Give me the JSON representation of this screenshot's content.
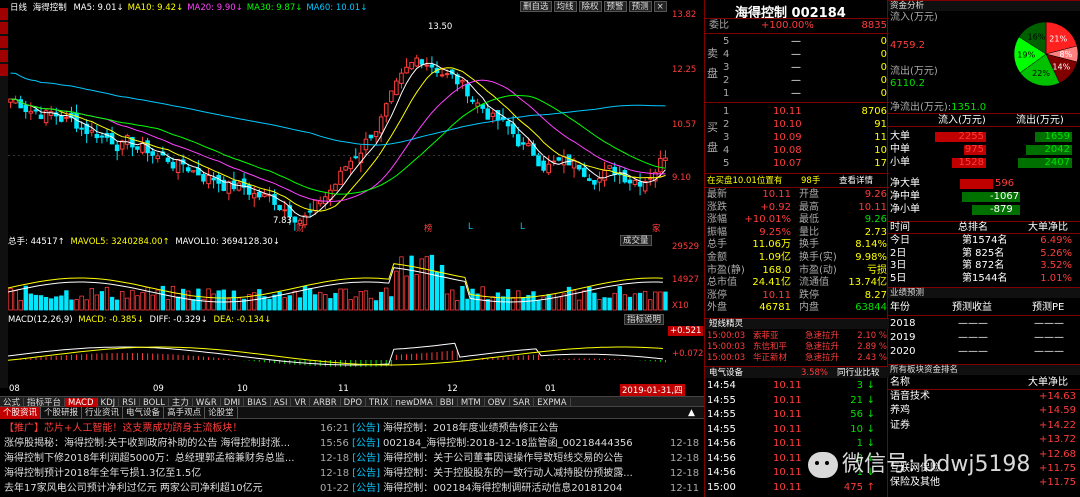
{
  "header": {
    "chart_type": "日线",
    "stock_name": "海得控制",
    "ma": [
      {
        "label": "MA5: 9.01",
        "arrow": "↓",
        "color": "#ffffff"
      },
      {
        "label": "MA10: 9.42",
        "arrow": "↓",
        "color": "#ffff00"
      },
      {
        "label": "MA20: 9.90",
        "arrow": "↓",
        "color": "#ff40ff"
      },
      {
        "label": "MA30: 9.87",
        "arrow": "↓",
        "color": "#00ff00"
      },
      {
        "label": "MA60: 10.01",
        "arrow": "↓",
        "color": "#00c8ff"
      }
    ],
    "tools": [
      "删自选",
      "均线",
      "除权",
      "预警",
      "预测"
    ]
  },
  "price_axis": [
    "13.82",
    "12.25",
    "10.57",
    "9.10"
  ],
  "price_labels": {
    "high": "13.50",
    "low": "7.83"
  },
  "markers": [
    "财",
    "榜",
    "L",
    "L",
    "家"
  ],
  "volume": {
    "label": "总手: 44517↑",
    "mavol5": "MAVOL5: 3240284.00↑",
    "mavol10": "MAVOL10: 3694128.30↓",
    "button": "成交量",
    "axis": [
      "29529",
      "14927",
      "X10"
    ]
  },
  "macd": {
    "label": "MACD(12,26,9)",
    "macd_val": "MACD: -0.385↓",
    "diff": "DIFF: -0.329↓",
    "dea": "DEA: -0.134↓",
    "button": "指标说明",
    "axis": [
      "+0.521",
      "+0.072"
    ]
  },
  "months": [
    "08",
    "09",
    "10",
    "11",
    "12",
    "01"
  ],
  "current_date": "2019-01-31,四",
  "indicator_tabs": [
    "公式",
    "指标平台",
    "MACD",
    "KDJ",
    "RSI",
    "BOLL",
    "主力",
    "W&R",
    "DMI",
    "BIAS",
    "ASI",
    "VR",
    "ARBR",
    "DPO",
    "TRIX",
    "newDMA",
    "BBI",
    "MTM",
    "OBV",
    "SAR",
    "EXPMA"
  ],
  "news_tabs": [
    "个股资讯",
    "个股研报",
    "行业资讯",
    "电气设备",
    "高手观点",
    "论股堂"
  ],
  "news_left": [
    "【推广】芯片+人工智能！这支票成功跻身主流板块！",
    "涨停股揭秘：海得控制:关于收到政府补助的公告 海得控制封涨...",
    "海得控制下修2018年利润超5000万：总经理郭孟榕兼财务总监...",
    "海得控制预计2018年全年亏损1.3亿至1.5亿",
    "去年17家风电公司预计净利过亿元 两家公司净利超10亿元"
  ],
  "news_right": [
    {
      "time": "16:21",
      "tag": "[公告]",
      "text": "海得控制：2018年度业绩预告修正公告",
      "date": ""
    },
    {
      "time": "15:56",
      "tag": "[公告]",
      "text": "002184_海得控制:2018-12-18监管函_00218444356",
      "date": "12-18"
    },
    {
      "time": "12-18",
      "tag": "[公告]",
      "text": "海得控制：关于公司董事因误操作导致短线交易的公告",
      "date": "12-18"
    },
    {
      "time": "12-18",
      "tag": "[公告]",
      "text": "海得控制：关于控股股东的一致行动人减持股份预披露...",
      "date": "12-18"
    },
    {
      "time": "01-22",
      "tag": "[公告]",
      "text": "海得控制：002184海得控制调研活动信息20181204",
      "date": "12-11"
    }
  ],
  "quote": {
    "title": "海得控制 002184",
    "webi_label": "委比",
    "webi": "+100.00%",
    "webi_val": "8835",
    "sell_label": "卖盘",
    "buy_label": "买盘",
    "sell": [
      {
        "n": "5",
        "p": "—",
        "v": "0"
      },
      {
        "n": "4",
        "p": "—",
        "v": "0"
      },
      {
        "n": "3",
        "p": "—",
        "v": "0"
      },
      {
        "n": "2",
        "p": "—",
        "v": "0"
      },
      {
        "n": "1",
        "p": "—",
        "v": "0"
      }
    ],
    "buy": [
      {
        "n": "1",
        "p": "10.11",
        "v": "8706"
      },
      {
        "n": "2",
        "p": "10.10",
        "v": "91"
      },
      {
        "n": "3",
        "p": "10.09",
        "v": "11"
      },
      {
        "n": "4",
        "p": "10.08",
        "v": "10"
      },
      {
        "n": "5",
        "p": "10.07",
        "v": "17"
      }
    ],
    "status": "在买盘10.01位置有",
    "status2": "98手",
    "status3": "查看详情",
    "stats": [
      [
        "最新",
        "10.11",
        "开盘",
        "9.26"
      ],
      [
        "涨跌",
        "+0.92",
        "最高",
        "10.11"
      ],
      [
        "涨幅",
        "+10.01%",
        "最低",
        "9.26"
      ],
      [
        "振幅",
        "9.25%",
        "量比",
        "2.73"
      ],
      [
        "总手",
        "11.06万",
        "换手",
        "8.14%"
      ],
      [
        "金额",
        "1.09亿",
        "换手(实)",
        "9.98%"
      ],
      [
        "市盈(静)",
        "168.0",
        "市盈(动)",
        "亏损"
      ],
      [
        "总市值",
        "24.41亿",
        "流通值",
        "13.74亿"
      ],
      [
        "涨停",
        "10.11",
        "跌停",
        "8.27"
      ],
      [
        "外盘",
        "46781",
        "内盘",
        "63844"
      ]
    ],
    "short_title": "短线精灵",
    "shorts": [
      {
        "t": "15:00:03",
        "n": "索菲亚",
        "e": "急速拉升",
        "v": "2.10 %"
      },
      {
        "t": "15:00:03",
        "n": "东信和平",
        "e": "急速拉升",
        "v": "2.89 %"
      },
      {
        "t": "15:00:03",
        "n": "华正新材",
        "e": "急速拉升",
        "v": "2.43 %"
      }
    ],
    "sector_label": "电气设备",
    "sector_val": "3.58%",
    "sector_compare": "同行业比较",
    "ticks": [
      {
        "t": "14:54",
        "p": "10.11",
        "v": "3",
        "a": "↓"
      },
      {
        "t": "14:55",
        "p": "10.11",
        "v": "21",
        "a": "↓"
      },
      {
        "t": "14:55",
        "p": "10.11",
        "v": "56",
        "a": "↓"
      },
      {
        "t": "14:55",
        "p": "10.11",
        "v": "10",
        "a": "↓"
      },
      {
        "t": "14:56",
        "p": "10.11",
        "v": "1",
        "a": "↓"
      },
      {
        "t": "14:56",
        "p": "10.11",
        "v": "3",
        "a": "↓"
      },
      {
        "t": "14:56",
        "p": "10.11",
        "v": "1",
        "a": "↓"
      },
      {
        "t": "15:00",
        "p": "10.11",
        "v": "475",
        "a": "↑"
      }
    ]
  },
  "fund": {
    "title": "资金分析",
    "inflow_label": "流入(万元)",
    "inflow": "4759.2",
    "outflow_label": "流出(万元)",
    "outflow": "6110.2",
    "net_label": "净流出(万元):",
    "net": "1351.0",
    "pie_labels": [
      "21%",
      "8%",
      "14%",
      "22%",
      "19%",
      "16%"
    ],
    "col1": "流入(万元)",
    "col2": "流出(万元)",
    "rows": [
      {
        "k": "大单",
        "in": "2255",
        "out": "1659"
      },
      {
        "k": "中单",
        "in": "975",
        "out": "2042"
      },
      {
        "k": "小单",
        "in": "1528",
        "out": "2407"
      }
    ],
    "net_rows": [
      {
        "k": "净大单",
        "v": "596"
      },
      {
        "k": "净中单",
        "v": "-1067"
      },
      {
        "k": "净小单",
        "v": "-879"
      }
    ],
    "rank_head": [
      "时间",
      "总排名",
      "大单净比"
    ],
    "ranks": [
      {
        "k": "今日",
        "r": "第1574名",
        "v": "6.49%"
      },
      {
        "k": "2日",
        "r": "第 825名",
        "v": "5.26%"
      },
      {
        "k": "3日",
        "r": "第 872名",
        "v": "3.52%"
      },
      {
        "k": "5日",
        "r": "第1544名",
        "v": "1.01%"
      }
    ],
    "forecast_title": "业绩预测",
    "forecast_head": [
      "年份",
      "预测收益",
      "预测PE"
    ],
    "forecast": [
      {
        "y": "2018",
        "a": "———",
        "b": "———"
      },
      {
        "y": "2019",
        "a": "———",
        "b": "———"
      },
      {
        "y": "2020",
        "a": "———",
        "b": "———"
      }
    ],
    "sector_title": "所有板块资金排名",
    "sector_head": [
      "名称",
      "大单净比"
    ],
    "sectors": [
      {
        "n": "语音技术",
        "v": "+14.63"
      },
      {
        "n": "养鸡",
        "v": "+14.59"
      },
      {
        "n": "证券",
        "v": "+14.22"
      },
      {
        "n": "",
        "v": "+13.72"
      },
      {
        "n": "",
        "v": "+12.68"
      },
      {
        "n": "互联网保险",
        "v": "+11.75"
      },
      {
        "n": "保险及其他",
        "v": "+11.75"
      }
    ],
    "watermark": "微信号: bdwj5198"
  }
}
